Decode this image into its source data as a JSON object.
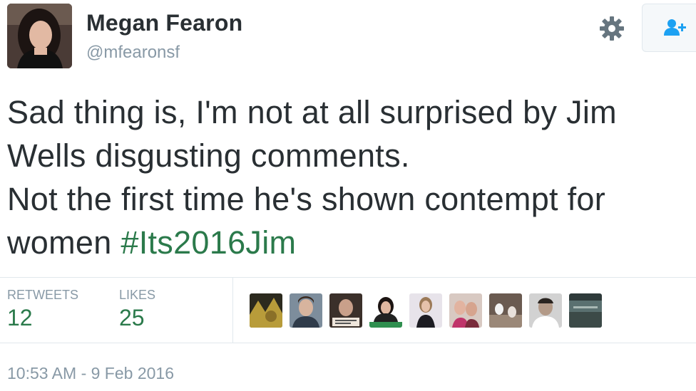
{
  "user": {
    "name": "Megan Fearon",
    "handle": "@mfearonsf"
  },
  "icons": {
    "settings": "gear-icon",
    "follow": "follow-user-icon"
  },
  "tweet": {
    "lines": [
      "Sad thing is, I'm not at all surprised by Jim",
      "Wells disgusting comments.",
      "Not the first time he's shown contempt for",
      "women "
    ],
    "hashtag": "#Its2016Jim"
  },
  "stats": {
    "retweets_label": "RETWEETS",
    "retweets_count": "12",
    "likes_label": "LIKES",
    "likes_count": "25"
  },
  "likers_count_shown": 9,
  "timestamp": "10:53 AM - 9 Feb 2016",
  "colors": {
    "text": "#292f33",
    "muted": "#8899a6",
    "accent": "#2b7a4b",
    "border": "#e1e8ed"
  }
}
